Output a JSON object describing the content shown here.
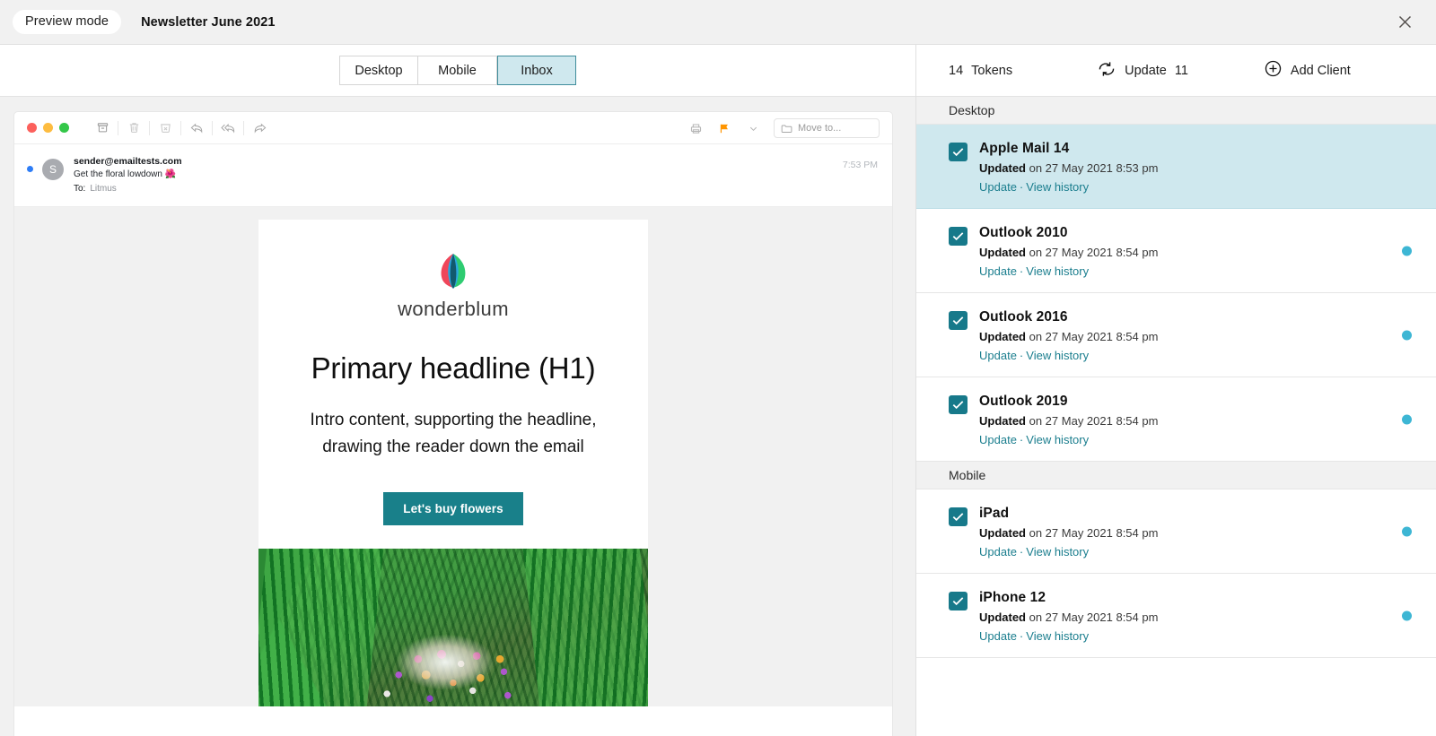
{
  "topbar": {
    "mode_pill": "Preview mode",
    "document_title": "Newsletter June 2021",
    "close_icon": "close-icon"
  },
  "view_tabs": [
    {
      "label": "Desktop",
      "active": false
    },
    {
      "label": "Mobile",
      "active": false
    },
    {
      "label": "Inbox",
      "active": true
    }
  ],
  "mail_client": {
    "toolbar_icons": [
      "archive-icon",
      "trash-icon",
      "junk-icon",
      "reply-icon",
      "reply-all-icon",
      "forward-icon",
      "print-icon",
      "flag-icon",
      "chevron-down-icon"
    ],
    "move_to_label": "Move to...",
    "avatar_initial": "S",
    "from": "sender@emailtests.com",
    "subject": "Get the floral lowdown 🌺",
    "to_label": "To:",
    "to_value": "Litmus",
    "time": "7:53 PM"
  },
  "email": {
    "logo_wordmark": "wonderblum",
    "headline": "Primary headline (H1)",
    "intro": "Intro content, supporting the headline, drawing the reader down the email",
    "cta_label": "Let's buy flowers",
    "hero_alt": "ferns-and-flowers-photo"
  },
  "right_panel": {
    "tokens_count": "14",
    "tokens_label": "Tokens",
    "update_label": "Update",
    "update_count": "11",
    "add_client_label": "Add Client",
    "refresh_icon": "refresh-icon",
    "plus_icon": "plus-circle-icon",
    "sections": [
      {
        "name": "Desktop",
        "clients": [
          {
            "name": "Apple Mail 14",
            "updated_prefix": "Updated",
            "updated_suffix": " on 27 May 2021 8:53 pm",
            "update_link": "Update",
            "separator": "·",
            "history_link": "View history",
            "checked": true,
            "selected": true,
            "has_status_dot": false
          },
          {
            "name": "Outlook 2010",
            "updated_prefix": "Updated",
            "updated_suffix": " on 27 May 2021 8:54 pm",
            "update_link": "Update",
            "separator": "·",
            "history_link": "View history",
            "checked": true,
            "selected": false,
            "has_status_dot": true
          },
          {
            "name": "Outlook 2016",
            "updated_prefix": "Updated",
            "updated_suffix": " on 27 May 2021 8:54 pm",
            "update_link": "Update",
            "separator": "·",
            "history_link": "View history",
            "checked": true,
            "selected": false,
            "has_status_dot": true
          },
          {
            "name": "Outlook 2019",
            "updated_prefix": "Updated",
            "updated_suffix": " on 27 May 2021 8:54 pm",
            "update_link": "Update",
            "separator": "·",
            "history_link": "View history",
            "checked": true,
            "selected": false,
            "has_status_dot": true
          }
        ]
      },
      {
        "name": "Mobile",
        "clients": [
          {
            "name": "iPad",
            "updated_prefix": "Updated",
            "updated_suffix": " on 27 May 2021 8:54 pm",
            "update_link": "Update",
            "separator": "·",
            "history_link": "View history",
            "checked": true,
            "selected": false,
            "has_status_dot": true
          },
          {
            "name": "iPhone 12",
            "updated_prefix": "Updated",
            "updated_suffix": " on 27 May 2021 8:54 pm",
            "update_link": "Update",
            "separator": "·",
            "history_link": "View history",
            "checked": true,
            "selected": false,
            "has_status_dot": true
          }
        ]
      }
    ]
  },
  "colors": {
    "accent_teal": "#17798a",
    "selected_row": "#cfe8ee",
    "status_dot": "#3db6d4",
    "cta": "#19808a",
    "link": "#1b7e8e"
  }
}
